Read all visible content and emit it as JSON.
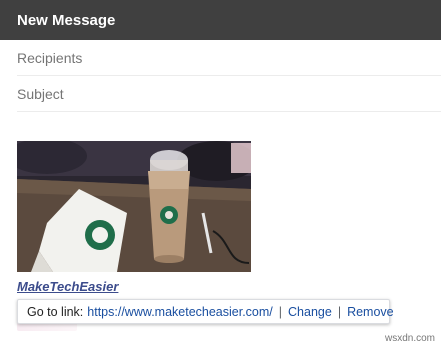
{
  "window": {
    "title": "New Message"
  },
  "compose": {
    "recipients_placeholder": "Recipients",
    "subject_placeholder": "Subject",
    "link_text": "MakeTechEasier"
  },
  "link_tooltip": {
    "go_to_label": "Go to link:",
    "url": "https://www.maketecheasier.com/",
    "separator": "|",
    "change_label": "Change",
    "remove_label": "Remove"
  },
  "watermark": "wsxdn.com",
  "colors": {
    "titlebar": "#404040",
    "link": "#3c4c8c",
    "tooltip_action": "#1a4fa0"
  }
}
